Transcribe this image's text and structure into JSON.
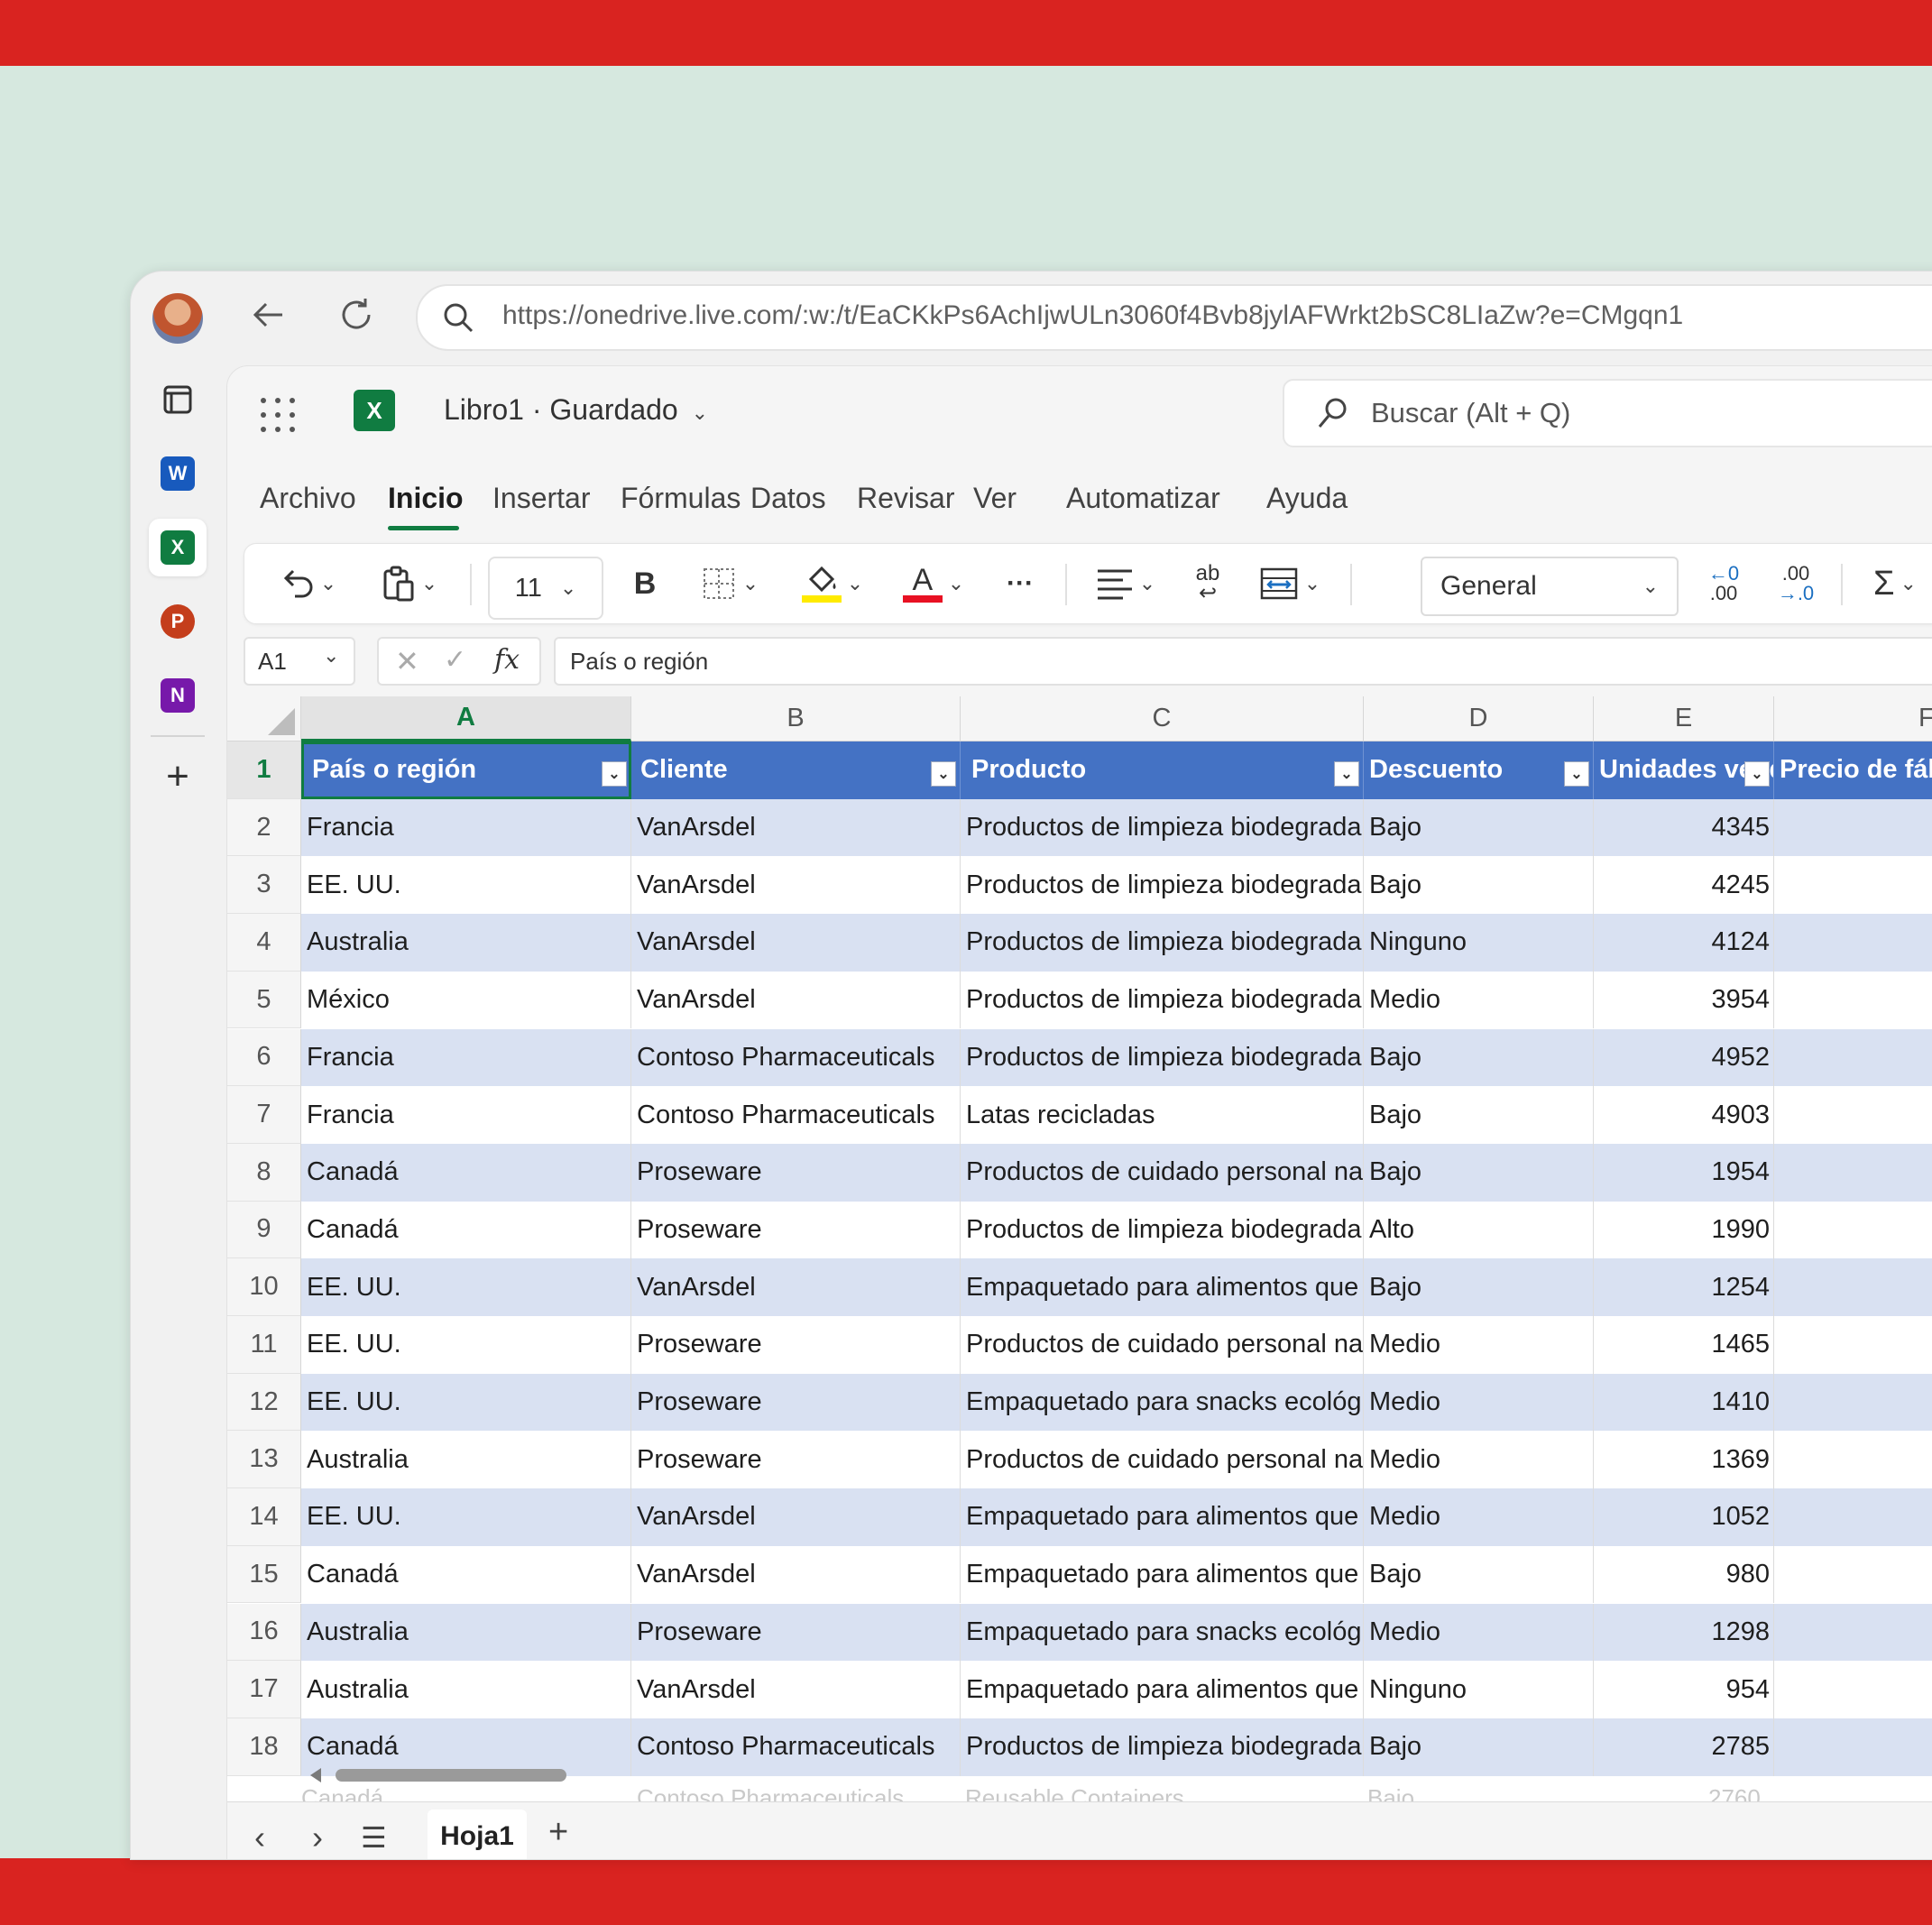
{
  "browser": {
    "url": "https://onedrive.live.com/:w:/t/EaCKkPs6AchIjwULn3060f4Bvb8jylAFWrkt2bSC8LIaZw?e=CMgqn1"
  },
  "rail": {
    "apps": [
      {
        "name": "word",
        "letter": "W",
        "color": "#185abd"
      },
      {
        "name": "excel",
        "letter": "X",
        "color": "#107c41"
      },
      {
        "name": "powerpoint",
        "letter": "P",
        "color": "#c43e1c"
      },
      {
        "name": "onenote",
        "letter": "N",
        "color": "#7719aa"
      }
    ]
  },
  "app": {
    "logo_letter": "X",
    "title": "Libro1 · Guardado",
    "search_placeholder": "Buscar (Alt + Q)"
  },
  "tabs": [
    "Archivo",
    "Inicio",
    "Insertar",
    "Fórmulas",
    "Datos",
    "Revisar",
    "Ver",
    "Automatizar",
    "Ayuda"
  ],
  "active_tab": "Inicio",
  "ribbon": {
    "font_size": "11",
    "bold_label": "B",
    "font_color_label": "A",
    "wrap_label": "ab",
    "number_format": "General",
    "inc_decimal_top": "←0",
    "inc_decimal_bottom": ".00",
    "dec_decimal_top": ".00",
    "dec_decimal_bottom": "→.0",
    "sum_label": "Σ",
    "more_label": "···",
    "highlight_color": "#ffeb00",
    "font_color": "#e81123"
  },
  "formula_bar": {
    "name_box": "A1",
    "fx": "fx",
    "content": "País o región"
  },
  "grid": {
    "columns": [
      "A",
      "B",
      "C",
      "D",
      "E",
      "F"
    ],
    "headers": [
      "País o región",
      "Cliente",
      "Producto",
      "Descuento",
      "Unidades vendidas",
      "Precio de fábrica"
    ],
    "rows": [
      {
        "n": "2",
        "pais": "Francia",
        "cliente": "VanArsdel",
        "producto": "Productos de limpieza biodegradables",
        "descuento": "Bajo",
        "unidades": "4345"
      },
      {
        "n": "3",
        "pais": "EE. UU.",
        "cliente": "VanArsdel",
        "producto": "Productos de limpieza biodegradables",
        "descuento": "Bajo",
        "unidades": "4245"
      },
      {
        "n": "4",
        "pais": "Australia",
        "cliente": "VanArsdel",
        "producto": "Productos de limpieza biodegradables",
        "descuento": "Ninguno",
        "unidades": "4124"
      },
      {
        "n": "5",
        "pais": "México",
        "cliente": "VanArsdel",
        "producto": "Productos de limpieza biodegradables",
        "descuento": "Medio",
        "unidades": "3954"
      },
      {
        "n": "6",
        "pais": "Francia",
        "cliente": "Contoso Pharmaceuticals",
        "producto": "Productos de limpieza biodegradables",
        "descuento": "Bajo",
        "unidades": "4952"
      },
      {
        "n": "7",
        "pais": "Francia",
        "cliente": "Contoso Pharmaceuticals",
        "producto": "Latas recicladas",
        "descuento": "Bajo",
        "unidades": "4903"
      },
      {
        "n": "8",
        "pais": "Canadá",
        "cliente": "Proseware",
        "producto": "Productos de cuidado personal naturales",
        "descuento": "Bajo",
        "unidades": "1954"
      },
      {
        "n": "9",
        "pais": "Canadá",
        "cliente": "Proseware",
        "producto": "Productos de limpieza biodegradables",
        "descuento": "Alto",
        "unidades": "1990"
      },
      {
        "n": "10",
        "pais": "EE. UU.",
        "cliente": "VanArsdel",
        "producto": "Empaquetado para alimentos que",
        "descuento": "Bajo",
        "unidades": "1254"
      },
      {
        "n": "11",
        "pais": "EE. UU.",
        "cliente": "Proseware",
        "producto": "Productos de cuidado personal naturales",
        "descuento": "Medio",
        "unidades": "1465"
      },
      {
        "n": "12",
        "pais": "EE. UU.",
        "cliente": "Proseware",
        "producto": "Empaquetado para snacks ecológicos",
        "descuento": "Medio",
        "unidades": "1410"
      },
      {
        "n": "13",
        "pais": "Australia",
        "cliente": "Proseware",
        "producto": "Productos de cuidado personal naturales",
        "descuento": "Medio",
        "unidades": "1369"
      },
      {
        "n": "14",
        "pais": "EE. UU.",
        "cliente": "VanArsdel",
        "producto": "Empaquetado para alimentos que",
        "descuento": "Medio",
        "unidades": "1052"
      },
      {
        "n": "15",
        "pais": "Canadá",
        "cliente": "VanArsdel",
        "producto": "Empaquetado para alimentos que",
        "descuento": "Bajo",
        "unidades": "980"
      },
      {
        "n": "16",
        "pais": "Australia",
        "cliente": "Proseware",
        "producto": "Empaquetado para snacks ecológicos",
        "descuento": "Medio",
        "unidades": "1298"
      },
      {
        "n": "17",
        "pais": "Australia",
        "cliente": "VanArsdel",
        "producto": "Empaquetado para alimentos que",
        "descuento": "Ninguno",
        "unidades": "954"
      },
      {
        "n": "18",
        "pais": "Canadá",
        "cliente": "Contoso Pharmaceuticals",
        "producto": "Productos de limpieza biodegradables",
        "descuento": "Bajo",
        "unidades": "2785"
      }
    ],
    "partial_row": {
      "n": "19",
      "pais": "Canadá",
      "cliente": "Contoso Pharmaceuticals",
      "producto": "Reusable Containers",
      "descuento": "Bajo",
      "unidades": "2760"
    }
  },
  "sheets": {
    "active": "Hoja1",
    "add_label": "+"
  },
  "colors": {
    "brand_red": "#d92320",
    "background": "#d6e8df",
    "excel_green": "#107c41",
    "table_header": "#4472c4",
    "table_band": "#d9e1f2"
  }
}
